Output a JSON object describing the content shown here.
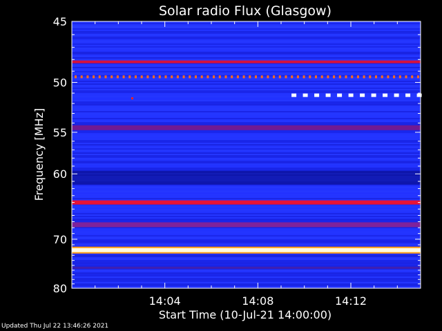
{
  "chart_data": {
    "type": "heatmap",
    "title": "Solar radio Flux (Glasgow)",
    "xlabel": "Start Time (10-Jul-21 14:00:00)",
    "ylabel": "Frequency [MHz]",
    "x_ticks": [
      "14:04",
      "14:08",
      "14:12"
    ],
    "x_tick_minutes": [
      4,
      8,
      12
    ],
    "xlim_minutes": [
      0,
      15
    ],
    "y_ticks": [
      45,
      50,
      55,
      60,
      70,
      80
    ],
    "yscale": "reciprocal",
    "ylim": [
      45,
      80
    ],
    "bands": [
      {
        "freq": 45.4,
        "intensity": "high-blue",
        "color": "#2a3cff"
      },
      {
        "freq": 48.2,
        "intensity": "medium-red",
        "color": "#e8102a"
      },
      {
        "freq": 49.5,
        "intensity": "intermittent-orange",
        "color": "#ff6a1a"
      },
      {
        "freq": 51.2,
        "intensity": "intermittent-white",
        "color": "#ffffff"
      },
      {
        "freq": 54.5,
        "intensity": "medium-purple",
        "color": "#7a1a8a"
      },
      {
        "freq": 60.5,
        "intensity": "dark-blue",
        "color": "#050a7a"
      },
      {
        "freq": 64.0,
        "intensity": "high-red",
        "color": "#ff1020"
      },
      {
        "freq": 67.5,
        "intensity": "medium-purple",
        "color": "#8a2090"
      },
      {
        "freq": 72.0,
        "intensity": "max-white",
        "color": "#fffbe0"
      },
      {
        "freq": 75.5,
        "intensity": "low-purple",
        "color": "#5a1a8a"
      }
    ],
    "colors": {
      "background": "#1f2fff",
      "plot_frame": "#ffffff"
    }
  },
  "footer": {
    "updated": "Updated Thu Jul 22 13:46:26 2021"
  }
}
